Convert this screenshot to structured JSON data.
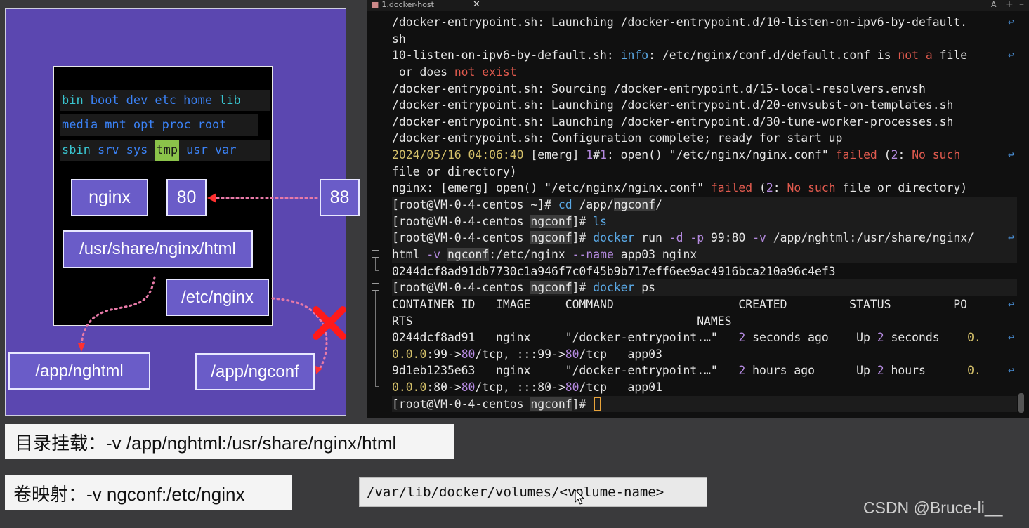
{
  "diagram": {
    "dir_rows": [
      [
        {
          "t": "bin",
          "c": "cyan"
        },
        {
          "t": "boot",
          "c": "blue"
        },
        {
          "t": "dev",
          "c": "blue"
        },
        {
          "t": "etc",
          "c": "blue"
        },
        {
          "t": "home",
          "c": "blue"
        },
        {
          "t": "lib",
          "c": "cyan"
        }
      ],
      [
        {
          "t": "media",
          "c": "blue"
        },
        {
          "t": "mnt",
          "c": "blue"
        },
        {
          "t": "opt",
          "c": "blue"
        },
        {
          "t": "proc",
          "c": "blue"
        },
        {
          "t": "root",
          "c": "blue"
        }
      ],
      [
        {
          "t": "sbin",
          "c": "cyan"
        },
        {
          "t": "srv",
          "c": "blue"
        },
        {
          "t": "sys",
          "c": "blue"
        },
        {
          "t": "tmp",
          "c": "tmp"
        },
        {
          "t": "usr",
          "c": "blue"
        },
        {
          "t": "var",
          "c": "blue"
        }
      ]
    ],
    "nginx_label": "nginx",
    "container_port": "80",
    "host_port": "88",
    "html_path": "/usr/share/nginx/html",
    "conf_path": "/etc/nginx",
    "host_html": "/app/nghtml",
    "host_conf": "/app/ngconf",
    "colors": {
      "panel": "#5b47b0",
      "box": "#6a5cc8",
      "arrow_pink": "#e84a8a",
      "cross": "#e81e1e"
    }
  },
  "captions": {
    "bind_mount": "目录挂载：-v /app/nghtml:/usr/share/nginx/html",
    "volume_mapping": "卷映射：-v ngconf:/etc/nginx",
    "volume_path": "/var/lib/docker/volumes/<volume-name>"
  },
  "watermark": "CSDN @Bruce-li__",
  "terminal": {
    "tab_title": "1.docker-host",
    "tab_close": "✕",
    "tab_font": "A",
    "tab_add": "+",
    "tab_min": "–",
    "wrap_glyph": "↩",
    "lines": [
      {
        "segs": [
          {
            "t": "/docker-entrypoint.sh"
          },
          {
            "t": ": Launching /docker-entrypoint.d/10-listen-on-ipv6-by-default."
          }
        ],
        "wrap": true
      },
      {
        "segs": [
          {
            "t": "sh"
          }
        ]
      },
      {
        "segs": [
          {
            "t": "10-listen-on-ipv6-by-default.sh"
          },
          {
            "t": ": "
          },
          {
            "t": "info",
            "c": "blue"
          },
          {
            "t": ": /etc/nginx/conf.d/default.conf is "
          },
          {
            "t": "not a",
            "c": "red"
          },
          {
            "t": " file"
          }
        ],
        "wrap": true
      },
      {
        "segs": [
          {
            "t": " or does "
          },
          {
            "t": "not exist",
            "c": "red"
          }
        ]
      },
      {
        "segs": [
          {
            "t": "/docker-entrypoint.sh: Sourcing /docker-entrypoint.d/15-local-resolvers.envsh"
          }
        ]
      },
      {
        "segs": [
          {
            "t": "/docker-entrypoint.sh: Launching /docker-entrypoint.d/20-envsubst-on-templates.sh"
          }
        ]
      },
      {
        "segs": [
          {
            "t": "/docker-entrypoint.sh: Launching /docker-entrypoint.d/30-tune-worker-processes.sh"
          }
        ]
      },
      {
        "segs": [
          {
            "t": "/docker-entrypoint.sh: Configuration complete; ready for start up"
          }
        ]
      },
      {
        "segs": [
          {
            "t": "2024/05/16 04:06:40",
            "c": "yellow"
          },
          {
            "t": " [emerg] "
          },
          {
            "t": "1",
            "c": "purple"
          },
          {
            "t": "#"
          },
          {
            "t": "1",
            "c": "purple"
          },
          {
            "t": ": open() \"/etc/nginx/nginx.conf\" "
          },
          {
            "t": "failed",
            "c": "red"
          },
          {
            "t": " ("
          },
          {
            "t": "2",
            "c": "purple"
          },
          {
            "t": ": "
          },
          {
            "t": "No such",
            "c": "red"
          }
        ],
        "wrap": true
      },
      {
        "segs": [
          {
            "t": "file or directory)"
          }
        ]
      },
      {
        "segs": [
          {
            "t": "nginx: [emerg] open() \"/etc/nginx/nginx.conf\" "
          },
          {
            "t": "failed",
            "c": "red"
          },
          {
            "t": " ("
          },
          {
            "t": "2",
            "c": "purple"
          },
          {
            "t": ": "
          },
          {
            "t": "No such",
            "c": "red"
          },
          {
            "t": " file or directory)"
          }
        ]
      },
      {
        "cmd": true,
        "segs": [
          {
            "t": "[root@VM-0-4-centos ~]# "
          },
          {
            "t": "cd",
            "c": "blue"
          },
          {
            "t": " /app/"
          },
          {
            "t": "ngconf",
            "c": "hl"
          },
          {
            "t": "/"
          }
        ]
      },
      {
        "cmd": true,
        "segs": [
          {
            "t": "[root@VM-0-4-centos "
          },
          {
            "t": "ngconf",
            "c": "hl"
          },
          {
            "t": "]# "
          },
          {
            "t": "ls",
            "c": "blue"
          }
        ]
      },
      {
        "cmd": true,
        "segs": [
          {
            "t": "[root@VM-0-4-centos "
          },
          {
            "t": "ngconf",
            "c": "hl"
          },
          {
            "t": "]# "
          },
          {
            "t": "docker",
            "c": "blue"
          },
          {
            "t": " run "
          },
          {
            "t": "-d -p",
            "c": "purple"
          },
          {
            "t": " 99:80 "
          },
          {
            "t": "-v",
            "c": "purple"
          },
          {
            "t": " /app/nghtml:/usr/share/nginx/"
          }
        ],
        "wrap": true
      },
      {
        "cmd": true,
        "segs": [
          {
            "t": "html "
          },
          {
            "t": "-v",
            "c": "purple"
          },
          {
            "t": " "
          },
          {
            "t": "ngconf",
            "c": "hl"
          },
          {
            "t": ":/etc/nginx "
          },
          {
            "t": "--name",
            "c": "purple"
          },
          {
            "t": " app03 nginx"
          }
        ]
      },
      {
        "segs": [
          {
            "t": "0244dcf8ad91db7730c1a946f7c0f45b9b717eff6ee9ac4916bca210a96c4ef3"
          }
        ]
      },
      {
        "cmd": true,
        "segs": [
          {
            "t": "[root@VM-0-4-centos "
          },
          {
            "t": "ngconf",
            "c": "hl"
          },
          {
            "t": "]# "
          },
          {
            "t": "docker",
            "c": "blue"
          },
          {
            "t": " ps"
          }
        ]
      },
      {
        "segs": [
          {
            "t": "CONTAINER ID   IMAGE     COMMAND                  CREATED         STATUS         PO"
          }
        ],
        "wrap": true
      },
      {
        "segs": [
          {
            "t": "RTS                                         NAMES"
          }
        ]
      },
      {
        "segs": [
          {
            "t": "0244dcf8ad91   nginx     \"/docker-entrypoint.…\"   "
          },
          {
            "t": "2",
            "c": "purple"
          },
          {
            "t": " seconds ago    Up "
          },
          {
            "t": "2",
            "c": "purple"
          },
          {
            "t": " seconds    "
          },
          {
            "t": "0.",
            "c": "yellow"
          }
        ],
        "wrap": true
      },
      {
        "segs": [
          {
            "t": "0.0.0",
            "c": "yellow"
          },
          {
            "t": ":99->"
          },
          {
            "t": "80",
            "c": "purple"
          },
          {
            "t": "/tcp, :::99->"
          },
          {
            "t": "80",
            "c": "purple"
          },
          {
            "t": "/tcp   app03"
          }
        ]
      },
      {
        "segs": [
          {
            "t": "9d1eb1235e63   nginx     \"/docker-entrypoint.…\"   "
          },
          {
            "t": "2",
            "c": "purple"
          },
          {
            "t": " hours ago      Up "
          },
          {
            "t": "2",
            "c": "purple"
          },
          {
            "t": " hours      "
          },
          {
            "t": "0.",
            "c": "yellow"
          }
        ],
        "wrap": true
      },
      {
        "segs": [
          {
            "t": "0.0.0",
            "c": "yellow"
          },
          {
            "t": ":80->"
          },
          {
            "t": "80",
            "c": "purple"
          },
          {
            "t": "/tcp, :::80->"
          },
          {
            "t": "80",
            "c": "purple"
          },
          {
            "t": "/tcp   app01"
          }
        ]
      },
      {
        "cmd": true,
        "cursor": true,
        "segs": [
          {
            "t": "[root@VM-0-4-centos "
          },
          {
            "t": "ngconf",
            "c": "hl"
          },
          {
            "t": "]# "
          }
        ]
      }
    ]
  }
}
